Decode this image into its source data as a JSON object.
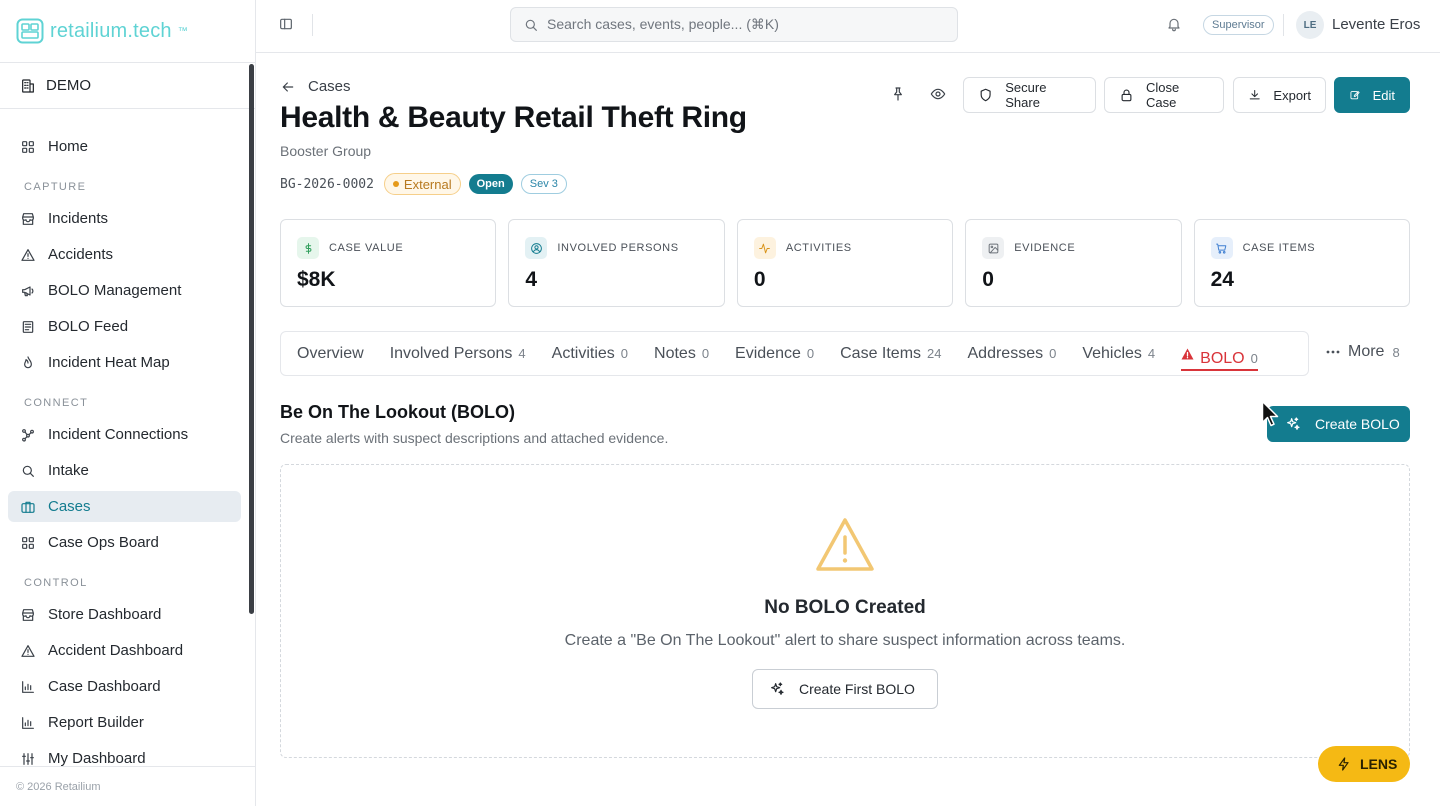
{
  "brand": {
    "name": "retailium.tech",
    "tm": "™"
  },
  "org": {
    "name": "DEMO"
  },
  "sidebar": {
    "home": "Home",
    "sections": {
      "capture": "CAPTURE",
      "connect": "CONNECT",
      "control": "CONTROL"
    },
    "capture_items": [
      "Incidents",
      "Accidents",
      "BOLO Management",
      "BOLO Feed",
      "Incident Heat Map"
    ],
    "connect_items": [
      "Incident Connections",
      "Intake",
      "Cases",
      "Case Ops Board"
    ],
    "control_items": [
      "Store Dashboard",
      "Accident Dashboard",
      "Case Dashboard",
      "Report Builder",
      "My Dashboard"
    ],
    "active": "Cases",
    "footer": "© 2026 Retailium"
  },
  "topbar": {
    "search_placeholder": "Search cases, events, people... (⌘K)",
    "role": "Supervisor",
    "avatar_initials": "LE",
    "user_name": "Levente Eros"
  },
  "case": {
    "back_label": "Cases",
    "title": "Health & Beauty Retail Theft Ring",
    "subtitle": "Booster Group",
    "id": "BG-2026-0002",
    "source": "External",
    "status": "Open",
    "severity": "Sev 3"
  },
  "actions": {
    "secure_share": "Secure Share",
    "close_case": "Close Case",
    "export": "Export",
    "edit": "Edit"
  },
  "stats": [
    {
      "label": "CASE VALUE",
      "value": "$8K",
      "icon": "dollar-icon",
      "color": "#2f9e5b",
      "bg": "#e6f6ec"
    },
    {
      "label": "INVOLVED PERSONS",
      "value": "4",
      "icon": "user-circle-icon",
      "color": "#137c8f",
      "bg": "#e3f1f4"
    },
    {
      "label": "ACTIVITIES",
      "value": "0",
      "icon": "activity-icon",
      "color": "#d9941a",
      "bg": "#fdf2df"
    },
    {
      "label": "EVIDENCE",
      "value": "0",
      "icon": "image-icon",
      "color": "#6b7178",
      "bg": "#eef0f2"
    },
    {
      "label": "CASE ITEMS",
      "value": "24",
      "icon": "cart-icon",
      "color": "#3f7fd1",
      "bg": "#e6effb"
    }
  ],
  "tabs": [
    {
      "label": "Overview",
      "count": ""
    },
    {
      "label": "Involved Persons",
      "count": "4"
    },
    {
      "label": "Activities",
      "count": "0"
    },
    {
      "label": "Notes",
      "count": "0"
    },
    {
      "label": "Evidence",
      "count": "0"
    },
    {
      "label": "Case Items",
      "count": "24"
    },
    {
      "label": "Addresses",
      "count": "0"
    },
    {
      "label": "Vehicles",
      "count": "4"
    },
    {
      "label": "BOLO",
      "count": "0"
    }
  ],
  "active_tab": "BOLO",
  "more": {
    "label": "More",
    "count": "8"
  },
  "bolo": {
    "title": "Be On The Lookout (BOLO)",
    "subtitle": "Create alerts with suspect descriptions and attached evidence.",
    "create_label": "Create BOLO",
    "empty_title": "No BOLO Created",
    "empty_text": "Create a \"Be On The Lookout\" alert to share suspect information across teams.",
    "first_label": "Create First BOLO"
  },
  "lens": {
    "label": "LENS"
  }
}
